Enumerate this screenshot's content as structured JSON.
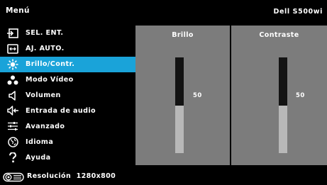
{
  "header": {
    "title": "Menú",
    "model": "Dell S500wi"
  },
  "menu": {
    "items": [
      {
        "label": "SEL. ENT.",
        "icon": "input-icon"
      },
      {
        "label": "AJ. AUTO.",
        "icon": "auto-adjust-icon"
      },
      {
        "label": "Brillo/Contr.",
        "icon": "brightness-icon",
        "active": true
      },
      {
        "label": "Modo Vídeo",
        "icon": "video-mode-icon"
      },
      {
        "label": "Volumen",
        "icon": "volume-icon"
      },
      {
        "label": "Entrada de audio",
        "icon": "audio-input-icon"
      },
      {
        "label": "Avanzado",
        "icon": "advanced-icon"
      },
      {
        "label": "Idioma",
        "icon": "language-icon"
      },
      {
        "label": "Ayuda",
        "icon": "help-icon"
      }
    ]
  },
  "brightness": {
    "title": "Brillo",
    "value": "50",
    "level": 0.5
  },
  "contrast": {
    "title": "Contraste",
    "value": "50",
    "level": 0.5
  },
  "footer": {
    "label": "Resolución",
    "resolution": "1280x800",
    "icon": "projector-icon"
  },
  "colors": {
    "highlight": "#1aa3d9",
    "panel": "#7c7c7c",
    "slider_fill": "#131313",
    "slider_track": "#b8b8b8"
  }
}
